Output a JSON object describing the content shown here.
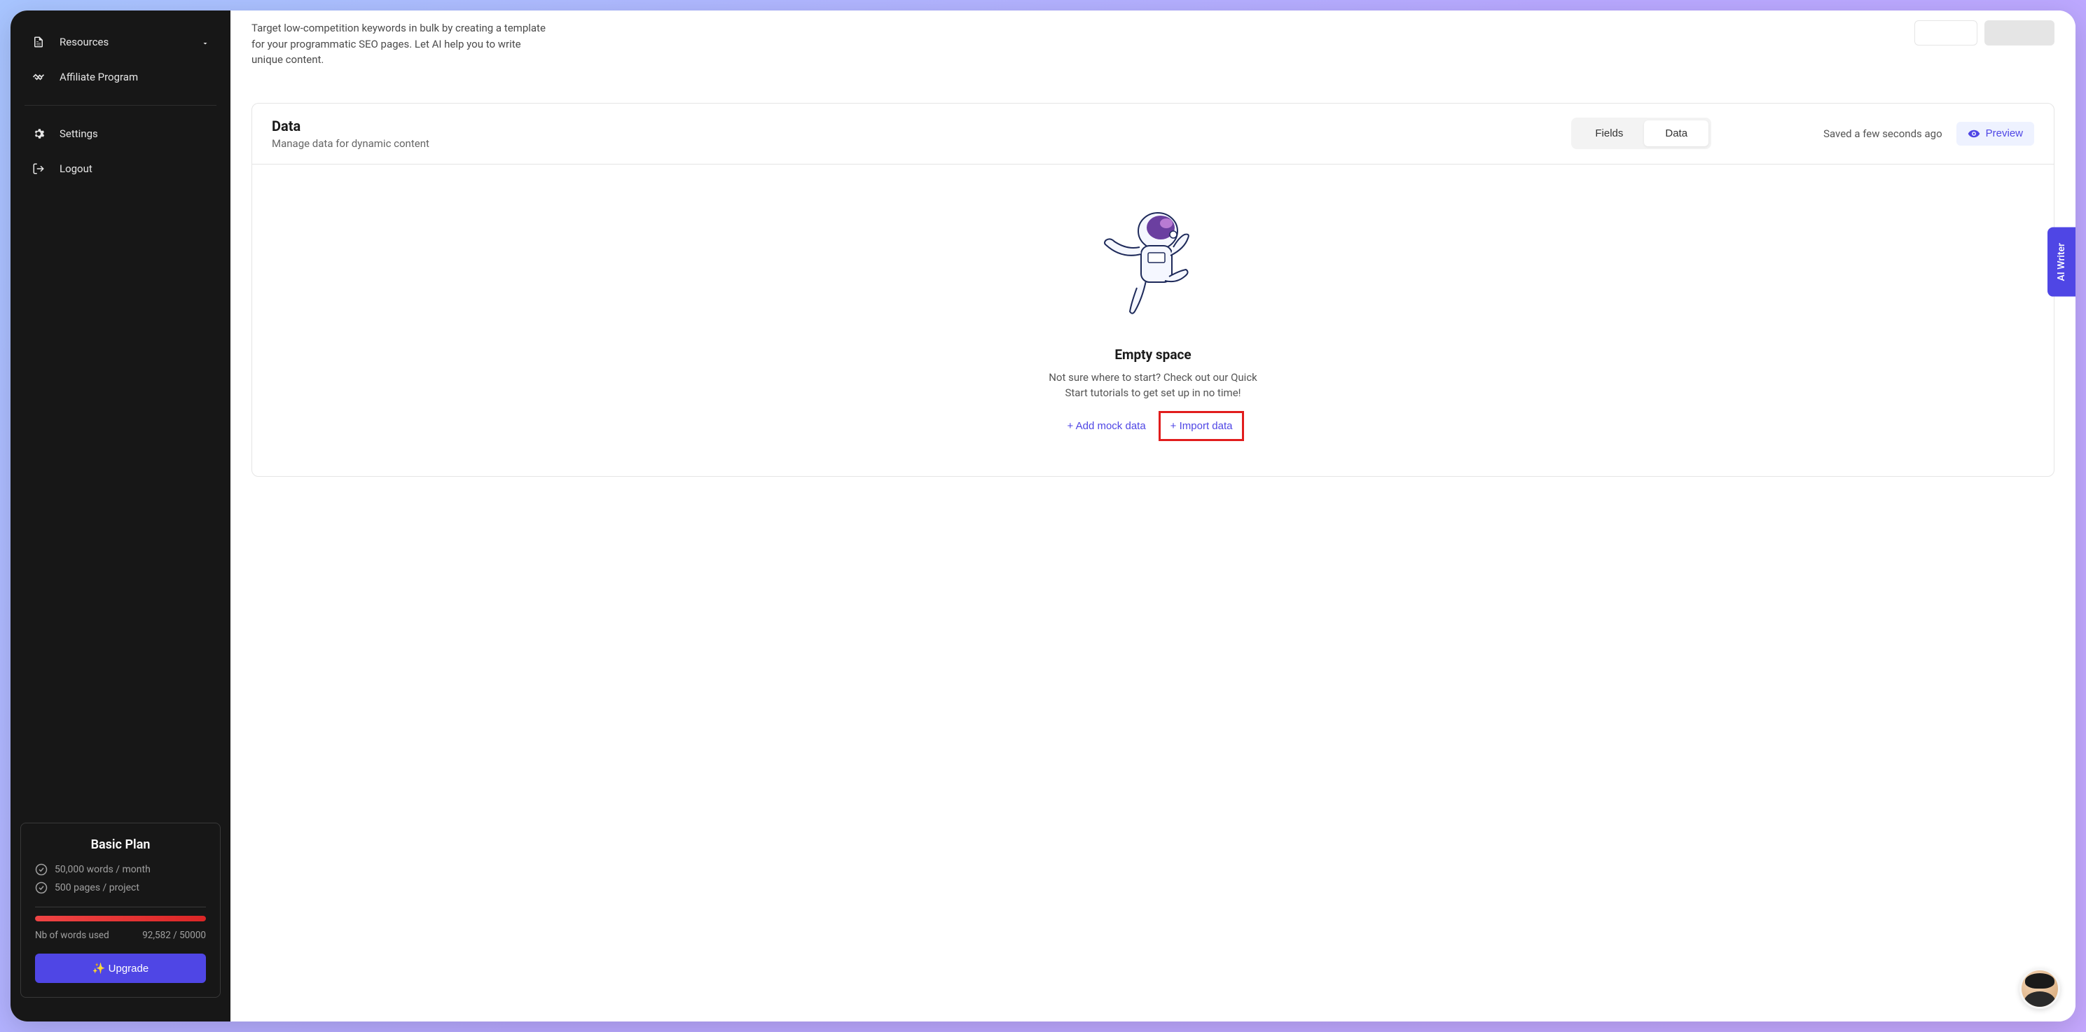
{
  "sidebar": {
    "items": [
      {
        "label": "Resources",
        "icon": "document"
      },
      {
        "label": "Affiliate Program",
        "icon": "handshake"
      },
      {
        "label": "Settings",
        "icon": "gear"
      },
      {
        "label": "Logout",
        "icon": "logout"
      }
    ]
  },
  "plan": {
    "title": "Basic Plan",
    "feature1": "50,000 words / month",
    "feature2": "500 pages / project",
    "usage_label": "Nb of words used",
    "usage_value": "92,582 / 50000",
    "upgrade_label": "✨ Upgrade"
  },
  "main": {
    "description": "Target low-competition keywords in bulk by creating a template for your programmatic SEO pages.  Let AI help you to write unique content."
  },
  "panel": {
    "title": "Data",
    "subtitle": "Manage data for dynamic content",
    "tab_fields": "Fields",
    "tab_data": "Data",
    "saved_text": "Saved a few seconds ago",
    "preview_label": "Preview"
  },
  "empty": {
    "title": "Empty space",
    "description": "Not sure where to start? Check out our Quick Start tutorials to get set up in no time!",
    "add_mock_label": "+ Add mock data",
    "import_label": "+ Import data"
  },
  "ai_writer": "AI Writer"
}
